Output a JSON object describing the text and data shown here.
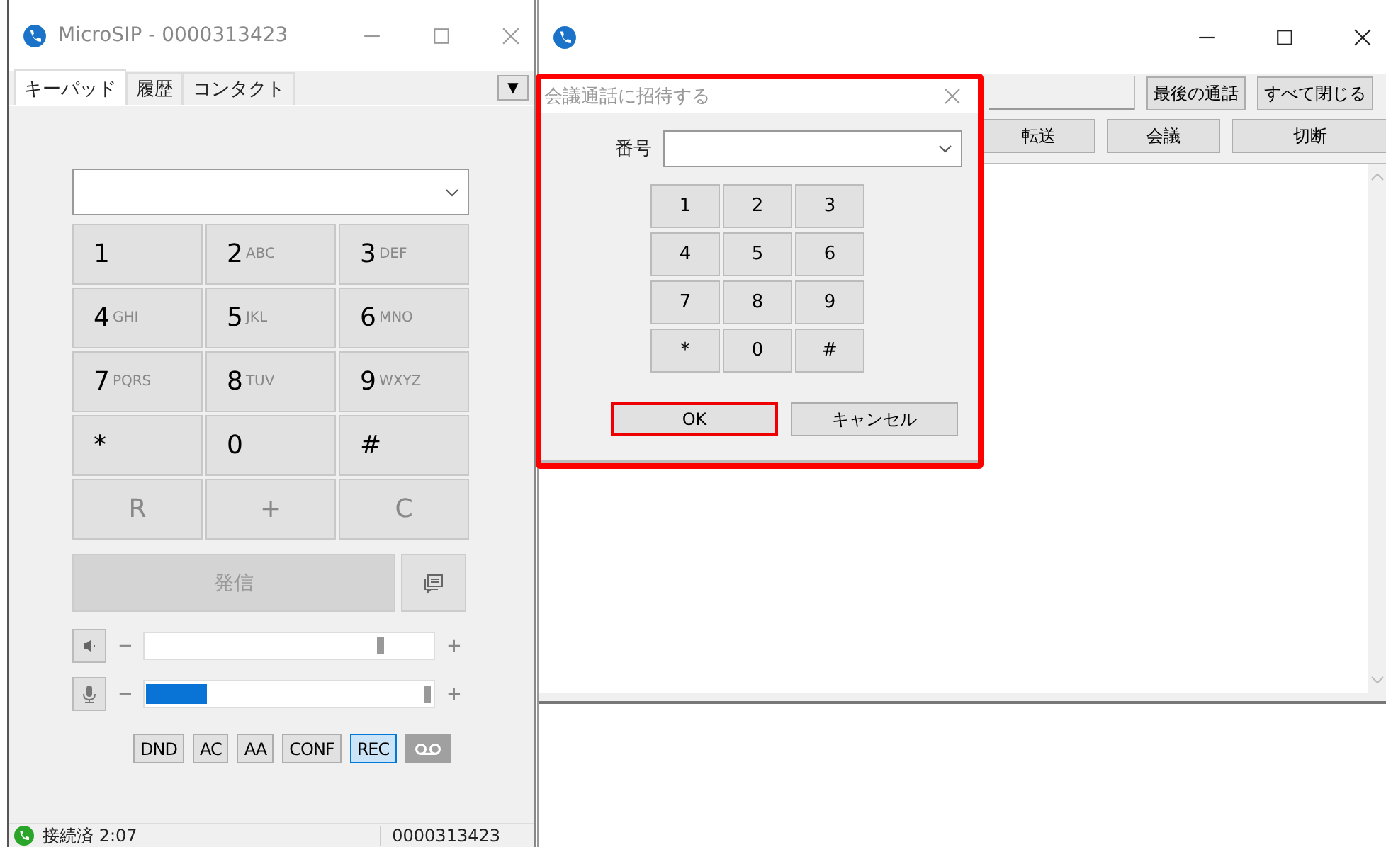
{
  "main_window": {
    "title": "MicroSIP - 0000313423",
    "tabs": [
      {
        "label": "キーパッド",
        "selected": true
      },
      {
        "label": "履歴",
        "selected": false
      },
      {
        "label": "コンタクト",
        "selected": false
      }
    ],
    "menu_button": "▼",
    "keypad": [
      {
        "digit": "1",
        "kind": "digit"
      },
      {
        "digit": "2",
        "letters": "ABC",
        "kind": "digit"
      },
      {
        "digit": "3",
        "letters": "DEF",
        "kind": "digit"
      },
      {
        "digit": "4",
        "letters": "GHI",
        "kind": "digit"
      },
      {
        "digit": "5",
        "letters": "JKL",
        "kind": "digit"
      },
      {
        "digit": "6",
        "letters": "MNO",
        "kind": "digit"
      },
      {
        "digit": "7",
        "letters": "PQRS",
        "kind": "digit"
      },
      {
        "digit": "8",
        "letters": "TUV",
        "kind": "digit"
      },
      {
        "digit": "9",
        "letters": "WXYZ",
        "kind": "digit"
      },
      {
        "digit": "*",
        "kind": "digit"
      },
      {
        "digit": "0",
        "kind": "digit"
      },
      {
        "digit": "#",
        "kind": "digit"
      },
      {
        "digit": "R",
        "kind": "action"
      },
      {
        "digit": "+",
        "kind": "action"
      },
      {
        "digit": "C",
        "kind": "action"
      }
    ],
    "call_button": {
      "label": "発信",
      "disabled": true
    },
    "speaker": {
      "minus": "−",
      "plus": "+",
      "level": 0.82
    },
    "microphone": {
      "minus": "−",
      "plus": "+",
      "level": 0.98,
      "input_meter": {
        "level": 0.21
      }
    },
    "toggles": [
      {
        "label": "DND",
        "on": false,
        "kind": "text"
      },
      {
        "label": "AC",
        "on": false,
        "kind": "text"
      },
      {
        "label": "AA",
        "on": false,
        "kind": "text"
      },
      {
        "label": "CONF",
        "on": false,
        "kind": "text"
      },
      {
        "label": "REC",
        "on": true,
        "kind": "text"
      },
      {
        "on": false,
        "kind": "voicemail"
      }
    ],
    "status_bar": {
      "status": "接続済 2:07",
      "account": "0000313423"
    }
  },
  "call_window": {
    "toolbar_buttons": [
      "最後の通話",
      "すべて閉じる"
    ],
    "call_buttons": [
      "転送",
      "会議",
      "切断"
    ]
  },
  "dialog": {
    "title": "会議通話に招待する",
    "number_label": "番号",
    "keys": [
      "1",
      "2",
      "3",
      "4",
      "5",
      "6",
      "7",
      "8",
      "9",
      "*",
      "0",
      "#"
    ],
    "buttons": [
      {
        "label": "OK",
        "focused": true
      },
      {
        "label": "キャンセル",
        "focused": false
      }
    ]
  }
}
